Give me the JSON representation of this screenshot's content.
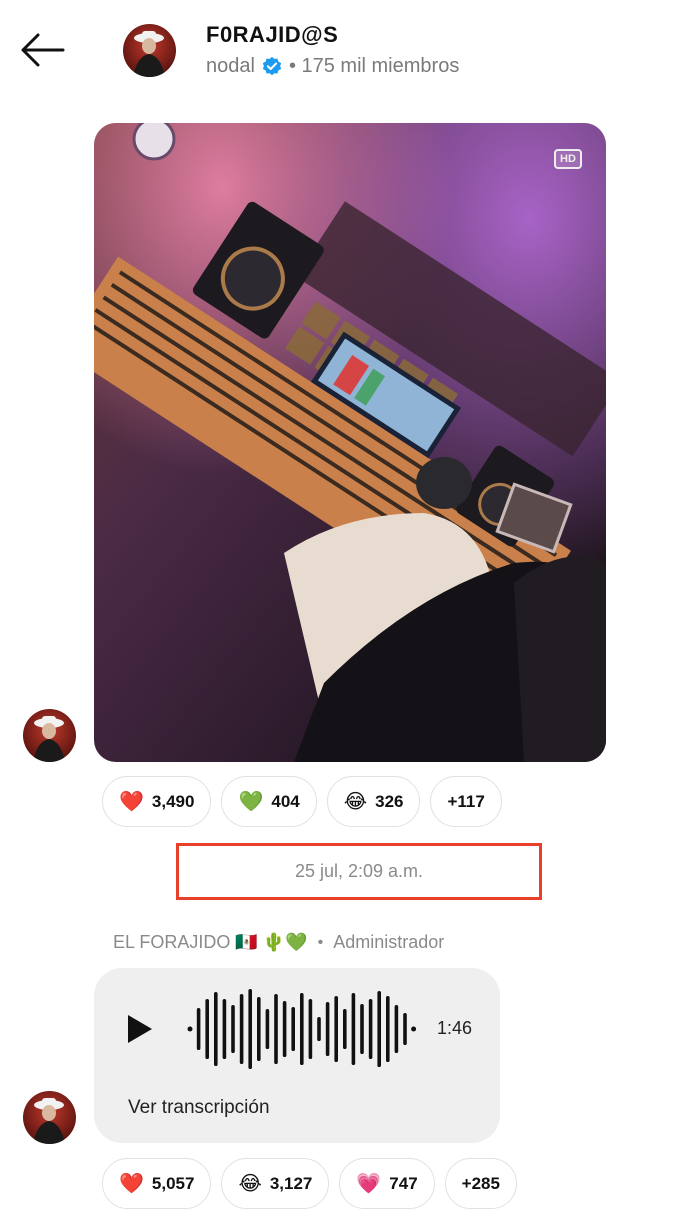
{
  "header": {
    "back_icon": "arrow-left-icon",
    "title": "F0RAJID@S",
    "owner": "nodal",
    "members": "• 175 mil miembros"
  },
  "post1": {
    "image_badge": "HD",
    "reactions": [
      {
        "emoji": "❤️",
        "count": "3,490"
      },
      {
        "emoji": "💚",
        "count": "404"
      },
      {
        "emoji": "😂",
        "count": "326"
      },
      {
        "emoji": "",
        "count": "+117"
      }
    ]
  },
  "timestamp": "25 jul, 2:09 a.m.",
  "post2": {
    "sender_name": "EL FORAJIDO 🇲🇽 🌵💚",
    "separator": "•",
    "sender_role": "Administrador",
    "audio_duration": "1:46",
    "transcript_label": "Ver transcripción",
    "reactions": [
      {
        "emoji": "❤️",
        "count": "5,057"
      },
      {
        "emoji": "😂",
        "count": "3,127"
      },
      {
        "emoji": "💗",
        "count": "747"
      },
      {
        "emoji": "",
        "count": "+285"
      }
    ]
  },
  "colors": {
    "highlight_box": "#e8402a",
    "verified": "#1d9bf0",
    "bubble": "#efefef"
  }
}
